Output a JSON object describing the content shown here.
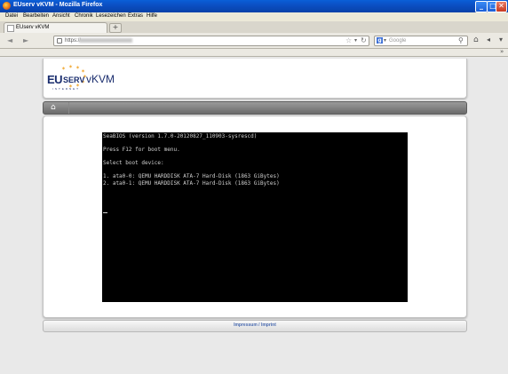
{
  "window": {
    "title": "EUserv vKVM - Mozilla Firefox",
    "buttons": {
      "minimize": "_",
      "maximize": "□",
      "close": "✕"
    }
  },
  "menu": [
    "Datei",
    "Bearbeiten",
    "Ansicht",
    "Chronik",
    "Lesezeichen",
    "Extras",
    "Hilfe"
  ],
  "tabs": [
    {
      "label": "EUserv vKVM",
      "active": true
    }
  ],
  "newtab_label": "+",
  "nav": {
    "back_icon": "◄",
    "forward_icon": "►",
    "url_prefix": "https://",
    "search_placeholder": "Google",
    "search_engine_glyph": "g"
  },
  "site": {
    "logo": {
      "eu": "EU",
      "serv": "SERV",
      "vkvm": "vKVM",
      "tagline": "INTERNET"
    },
    "footer_link": "Impressum / Imprint"
  },
  "console": {
    "lines": [
      "SeaBIOS (version 1.7.0-20120827_110903-sysrescd)",
      "",
      "Press F12 for boot menu.",
      "",
      "Select boot device:",
      "",
      "1. ata0-0: QEMU HARDDISK ATA-7 Hard-Disk (1863 GiBytes)",
      "2. ata0-1: QEMU HARDDISK ATA-7 Hard-Disk (1863 GiBytes)"
    ]
  },
  "colors": {
    "titlebar": "#0b4fc4",
    "console_bg": "#000000",
    "console_fg": "#d0d0d0",
    "logo_blue": "#1a2d6e",
    "logo_star": "#f0a020",
    "footer_link": "#4a6bb0"
  }
}
